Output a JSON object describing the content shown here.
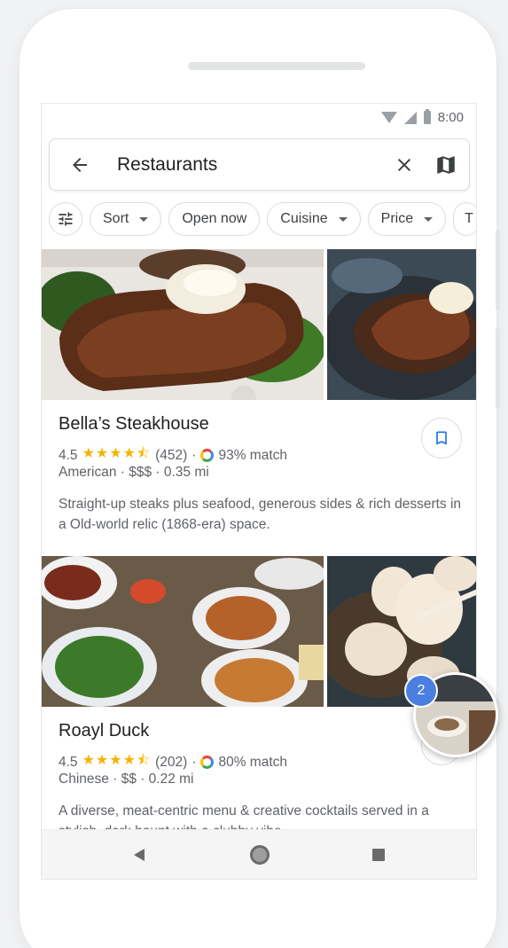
{
  "status_bar": {
    "time": "8:00"
  },
  "search": {
    "query": "Restaurants",
    "back_icon": "arrow-back-icon",
    "clear_icon": "close-icon",
    "map_icon": "map-icon"
  },
  "filters": {
    "options_icon": "tune-icon",
    "chips": [
      {
        "label": "Sort",
        "dropdown": true
      },
      {
        "label": "Open now",
        "dropdown": false
      },
      {
        "label": "Cuisine",
        "dropdown": true
      },
      {
        "label": "Price",
        "dropdown": true
      },
      {
        "label": "T",
        "dropdown": false
      }
    ]
  },
  "results": [
    {
      "name": "Bella’s Steakhouse",
      "rating": "4.5",
      "stars": "★★★★⯪",
      "reviews": "(452)",
      "dot": "·",
      "match": "93% match",
      "meta": "American · $$$ · 0.35 mi",
      "description": "Straight-up steaks plus seafood, generous sides & rich desserts in a Old-world relic (1868-era) space."
    },
    {
      "name": "Roayl Duck",
      "rating": "4.5",
      "stars": "★★★★⯪",
      "reviews": "(202)",
      "dot": "·",
      "match": "80% match",
      "meta": "Chinese · $$ · 0.22 mi",
      "description": "A diverse, meat-centric menu & creative cocktails served in a stylish, dark haunt with a clubby vibe."
    }
  ],
  "floating_badge": {
    "count": "2"
  },
  "colors": {
    "star": "#f4b400",
    "accent": "#1a73e8",
    "badge": "#4a7fe0"
  }
}
